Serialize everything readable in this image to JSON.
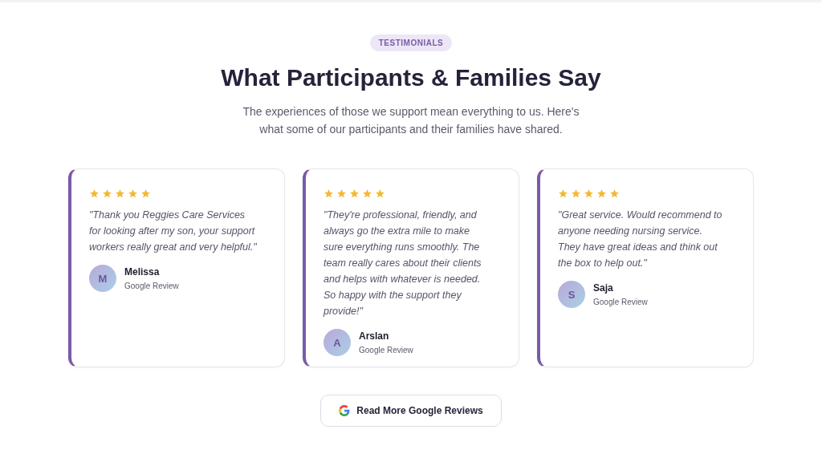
{
  "badge": "TESTIMONIALS",
  "heading": "What Participants & Families Say",
  "intro": "The experiences of those we support mean everything to us. Here's what some of our participants and their families have shared.",
  "testimonials": [
    {
      "stars": 5,
      "quote": "\"Thank you Reggies Care Services for looking after my son, your support workers really great and very helpful.\"",
      "initial": "M",
      "name": "Melissa",
      "source": "Google Review"
    },
    {
      "stars": 5,
      "quote": "\"They're professional, friendly, and always go the extra mile to make sure everything runs smoothly. The team really cares about their clients and helps with whatever is needed. So happy with the support they provide!\"",
      "initial": "A",
      "name": "Arslan",
      "source": "Google Review"
    },
    {
      "stars": 5,
      "quote": "\"Great service. Would recommend to anyone needing nursing service. They have great ideas and think out the box to help out.\"",
      "initial": "S",
      "name": "Saja",
      "source": "Google Review"
    }
  ],
  "button": "Read More Google Reviews"
}
